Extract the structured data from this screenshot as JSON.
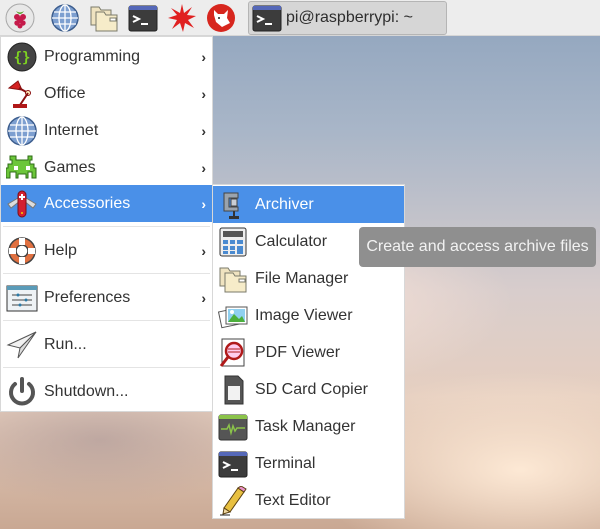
{
  "taskbar": {
    "launchers": [
      {
        "name": "raspberry-menu",
        "icon": "raspberry-icon"
      },
      {
        "name": "web-browser",
        "icon": "globe-icon"
      },
      {
        "name": "file-manager",
        "icon": "folder-icon"
      },
      {
        "name": "terminal",
        "icon": "terminal-icon"
      },
      {
        "name": "mathematica",
        "icon": "star-burst-icon"
      },
      {
        "name": "wolfram",
        "icon": "wolf-icon"
      }
    ],
    "task_button": {
      "label": "pi@raspberrypi: ~",
      "icon": "terminal-icon"
    }
  },
  "main_menu": {
    "items": [
      {
        "label": "Programming",
        "icon": "programming-icon",
        "submenu": true
      },
      {
        "label": "Office",
        "icon": "lamp-icon",
        "submenu": true
      },
      {
        "label": "Internet",
        "icon": "globe-icon",
        "submenu": true
      },
      {
        "label": "Games",
        "icon": "space-invader-icon",
        "submenu": true
      },
      {
        "label": "Accessories",
        "icon": "swiss-knife-icon",
        "submenu": true,
        "active": true
      },
      {
        "label": "Help",
        "icon": "lifebuoy-icon",
        "submenu": true
      },
      {
        "label": "Preferences",
        "icon": "sliders-icon",
        "submenu": true
      },
      {
        "label": "Run...",
        "icon": "paper-plane-icon",
        "submenu": false
      },
      {
        "label": "Shutdown...",
        "icon": "power-icon",
        "submenu": false
      }
    ],
    "arrow": "›"
  },
  "sub_menu": {
    "items": [
      {
        "label": "Archiver",
        "icon": "clamp-icon",
        "active": true
      },
      {
        "label": "Calculator",
        "icon": "calculator-icon"
      },
      {
        "label": "File Manager",
        "icon": "folder-icon"
      },
      {
        "label": "Image Viewer",
        "icon": "image-icon"
      },
      {
        "label": "PDF Viewer",
        "icon": "pdf-magnifier-icon"
      },
      {
        "label": "SD Card Copier",
        "icon": "sd-card-icon"
      },
      {
        "label": "Task Manager",
        "icon": "task-monitor-icon"
      },
      {
        "label": "Terminal",
        "icon": "terminal-icon"
      },
      {
        "label": "Text Editor",
        "icon": "pencil-icon"
      }
    ]
  },
  "tooltip": {
    "text": "Create and access archive files"
  },
  "colors": {
    "highlight": "#4a90e8",
    "tooltip_bg": "#8f8f8f"
  }
}
